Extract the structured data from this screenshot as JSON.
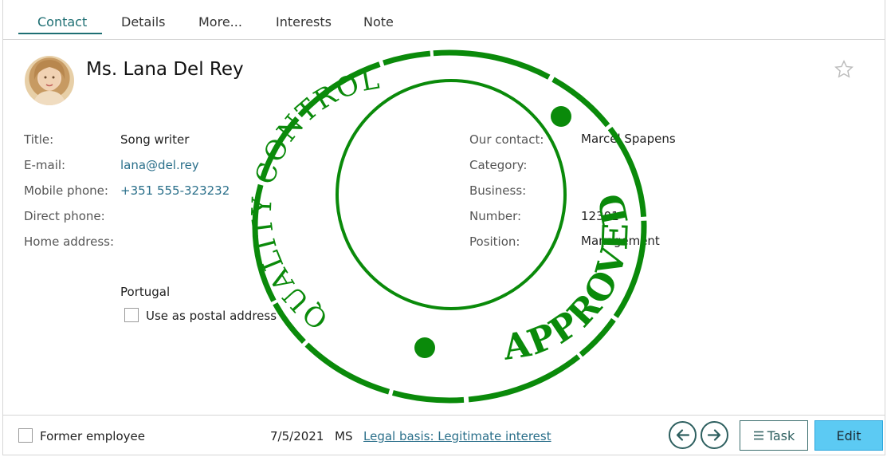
{
  "tabs": [
    {
      "label": "Contact"
    },
    {
      "label": "Details"
    },
    {
      "label": "More..."
    },
    {
      "label": "Interests"
    },
    {
      "label": "Note"
    }
  ],
  "contact": {
    "name": "Ms. Lana Del Rey"
  },
  "left_fields": {
    "title_label": "Title:",
    "title_value": "Song writer",
    "email_label": "E-mail:",
    "email_value": "lana@del.rey",
    "mobile_label": "Mobile phone:",
    "mobile_value": "+351 555-323232",
    "direct_label": "Direct phone:",
    "home_label": "Home address:",
    "country": "Portugal",
    "postal_label": "Use as postal address"
  },
  "right_fields": {
    "our_contact_label": "Our contact:",
    "our_contact_value": "Marcel Spapens",
    "category_label": "Category:",
    "business_label": "Business:",
    "number_label": "Number:",
    "number_value": "12301",
    "position_label": "Position:",
    "position_value": "Management"
  },
  "stamp": {
    "top_text": "QUALITY CONTROL",
    "bottom_text": "APPROVED",
    "color": "#0a8a0a"
  },
  "footer": {
    "former_employee_label": "Former employee",
    "date": "7/5/2021",
    "initials": "MS",
    "legal_basis": "Legal basis: Legitimate interest",
    "task_label": "Task",
    "edit_label": "Edit"
  },
  "colors": {
    "accent": "#1e6f73",
    "link": "#2a6f8a",
    "edit_button": "#5ccaf3"
  }
}
